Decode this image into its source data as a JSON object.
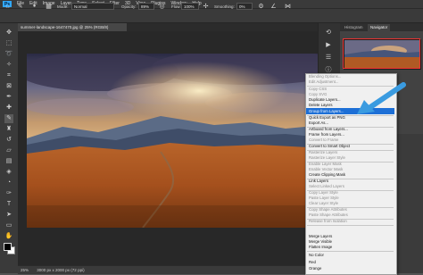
{
  "menubar": {
    "logo": "Ps",
    "items": [
      "File",
      "Edit",
      "Image",
      "Layer",
      "Type",
      "Select",
      "Filter",
      "3D",
      "View",
      "Plugins",
      "Window",
      "Help"
    ]
  },
  "options": {
    "mode_label": "Mode:",
    "mode_value": "Normal",
    "opacity_label": "Opacity:",
    "opacity_value": "89%",
    "flow_label": "Flow:",
    "flow_value": "100%",
    "smoothing_label": "Smoothing:",
    "smoothing_value": "0%"
  },
  "document": {
    "tab_title": "summer-landscape-1647470.jpg @ 25% (RGB/8)",
    "zoom": "25%",
    "status": "3000 px x 2000 px (72 ppi)"
  },
  "panels": {
    "tab_histogram": "Histogram",
    "tab_navigator": "Navigator"
  },
  "context_menu": {
    "highlighted": "Group from Layers...",
    "items": [
      {
        "label": "Blending Options...",
        "enabled": false
      },
      {
        "label": "Edit Adjustment...",
        "enabled": false
      },
      {
        "label": "Copy CSS",
        "enabled": false
      },
      {
        "label": "Copy SVG",
        "enabled": false
      },
      {
        "label": "Duplicate Layers...",
        "enabled": true
      },
      {
        "label": "Delete Layers",
        "enabled": true
      },
      {
        "label": "Group from Layers...",
        "enabled": true
      },
      {
        "label": "Quick Export as PNG",
        "enabled": true
      },
      {
        "label": "Export As...",
        "enabled": true
      },
      {
        "label": "Artboard from Layers...",
        "enabled": true
      },
      {
        "label": "Frame from Layers...",
        "enabled": true
      },
      {
        "label": "Convert to Frame",
        "enabled": false
      },
      {
        "label": "Convert to Smart Object",
        "enabled": true
      },
      {
        "label": "Rasterize Layers",
        "enabled": false
      },
      {
        "label": "Rasterize Layer Style",
        "enabled": false
      },
      {
        "label": "Enable Layer Mask",
        "enabled": false
      },
      {
        "label": "Enable Vector Mask",
        "enabled": false
      },
      {
        "label": "Create Clipping Mask",
        "enabled": true
      },
      {
        "label": "Link Layers",
        "enabled": true
      },
      {
        "label": "Select Linked Layers",
        "enabled": false
      },
      {
        "label": "Copy Layer Style",
        "enabled": false
      },
      {
        "label": "Paste Layer Style",
        "enabled": false
      },
      {
        "label": "Clear Layer Style",
        "enabled": false
      },
      {
        "label": "Copy Shape Attributes",
        "enabled": false
      },
      {
        "label": "Paste Shape Attributes",
        "enabled": false
      },
      {
        "label": "Release from Isolation",
        "enabled": false
      },
      {
        "label": "Merge Layers",
        "enabled": true
      },
      {
        "label": "Merge Visible",
        "enabled": true
      },
      {
        "label": "Flatten Image",
        "enabled": true
      },
      {
        "label": "No Color",
        "enabled": true
      },
      {
        "label": "Red",
        "enabled": true
      },
      {
        "label": "Orange",
        "enabled": true
      }
    ]
  },
  "colors": {
    "accent": "#1d6fd6",
    "arrow": "#3a9be0",
    "ui_dark": "#3a3a3a"
  }
}
